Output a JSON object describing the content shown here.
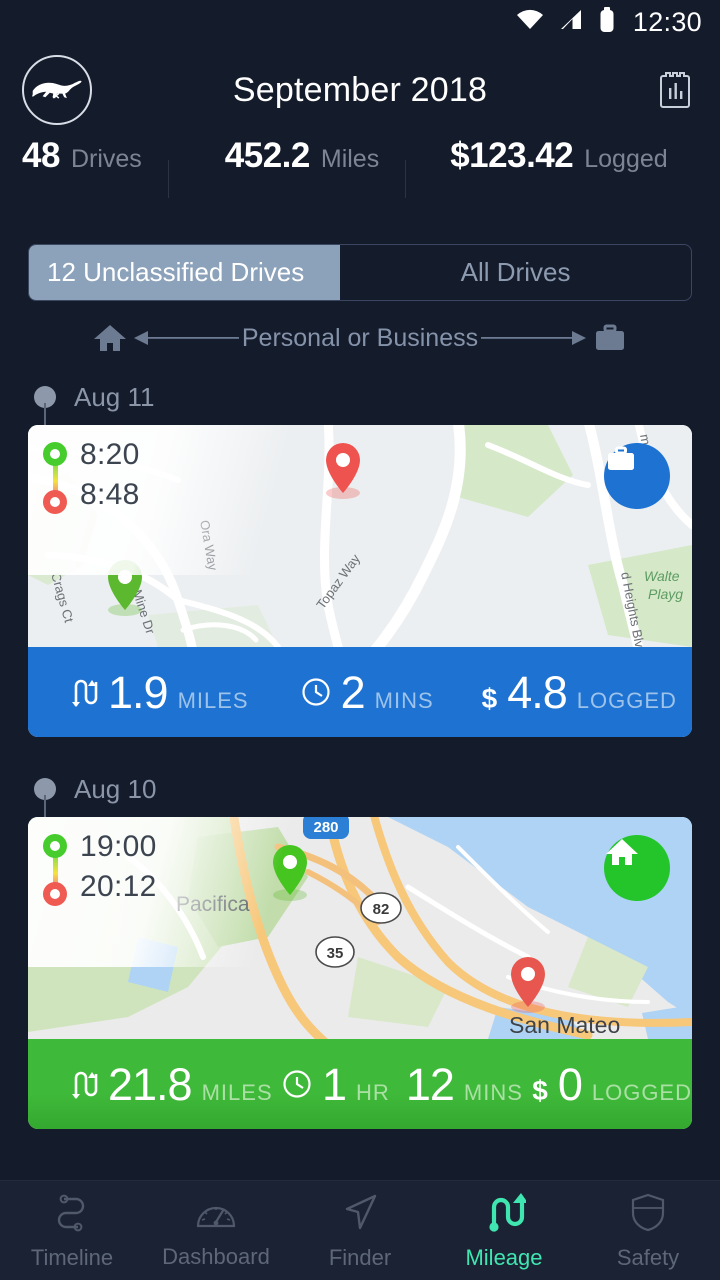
{
  "status_bar": {
    "time": "12:30",
    "icons": [
      "wifi-icon",
      "cell-signal-icon",
      "battery-icon"
    ]
  },
  "header": {
    "logo": "mustang-pony-logo",
    "title": "September 2018",
    "report_icon": "notebook-report-icon"
  },
  "summary": {
    "drives": {
      "value": "48",
      "label": "Drives"
    },
    "miles": {
      "value": "452.2",
      "label": "Miles"
    },
    "logged": {
      "value": "$123.42",
      "label": "Logged"
    }
  },
  "tabs": [
    {
      "label": "12 Unclassified Drives",
      "active": true
    },
    {
      "label": "All Drives",
      "active": false
    }
  ],
  "swipe_hint": {
    "left_icon": "home-icon",
    "right_icon": "briefcase-icon",
    "text": "Personal or Business"
  },
  "drives": [
    {
      "day": "Aug 11",
      "start_time": "8:20",
      "end_time": "8:48",
      "category": "business",
      "badge_icon": "briefcase-icon",
      "badge_color": "#1d72d2",
      "bar_color": "#1d72d2",
      "miles": {
        "value": "1.9",
        "unit": "MILES"
      },
      "duration": {
        "hours": "",
        "hours_unit": "",
        "mins": "2",
        "mins_unit": "MINS"
      },
      "cost": {
        "currency": "$",
        "value": "4.8",
        "label": "LOGGED"
      },
      "map": {
        "street_labels": [
          "Gold Mine Dr",
          "Ora Way",
          "Crags Ct",
          "Topaz Way",
          "d Heights Blvd",
          "mond St"
        ],
        "place_labels": [
          "Walte",
          "Playg"
        ],
        "start_pin": "green-map-pin",
        "end_pin": "red-map-pin"
      }
    },
    {
      "day": "Aug 10",
      "start_time": "19:00",
      "end_time": "20:12",
      "category": "personal",
      "badge_icon": "home-icon",
      "badge_color": "#23c52b",
      "bar_color": "#3fb93a",
      "miles": {
        "value": "21.8",
        "unit": "MILES"
      },
      "duration": {
        "hours": "1",
        "hours_unit": "HR",
        "mins": "12",
        "mins_unit": "MINS"
      },
      "cost": {
        "currency": "$",
        "value": "0",
        "label": "LOGGED"
      },
      "map": {
        "place_labels": [
          "Pacifica",
          "San Mateo"
        ],
        "route_shields": [
          "280",
          "82",
          "35"
        ],
        "start_pin": "green-map-pin",
        "end_pin": "red-map-pin"
      }
    }
  ],
  "bottom_nav": [
    {
      "label": "Timeline",
      "icon": "route-icon",
      "active": false
    },
    {
      "label": "Dashboard",
      "icon": "gauge-icon",
      "active": false
    },
    {
      "label": "Finder",
      "icon": "navigation-arrow-icon",
      "active": false
    },
    {
      "label": "Mileage",
      "icon": "mileage-arrows-icon",
      "active": true
    },
    {
      "label": "Safety",
      "icon": "shield-icon",
      "active": false
    }
  ],
  "theme": {
    "background": "#141b2b",
    "nav_background": "#1b2233",
    "accent": "#3fe6b0",
    "business_blue": "#1d72d2",
    "personal_green": "#3fb93a",
    "muted_text": "#7d8594"
  }
}
